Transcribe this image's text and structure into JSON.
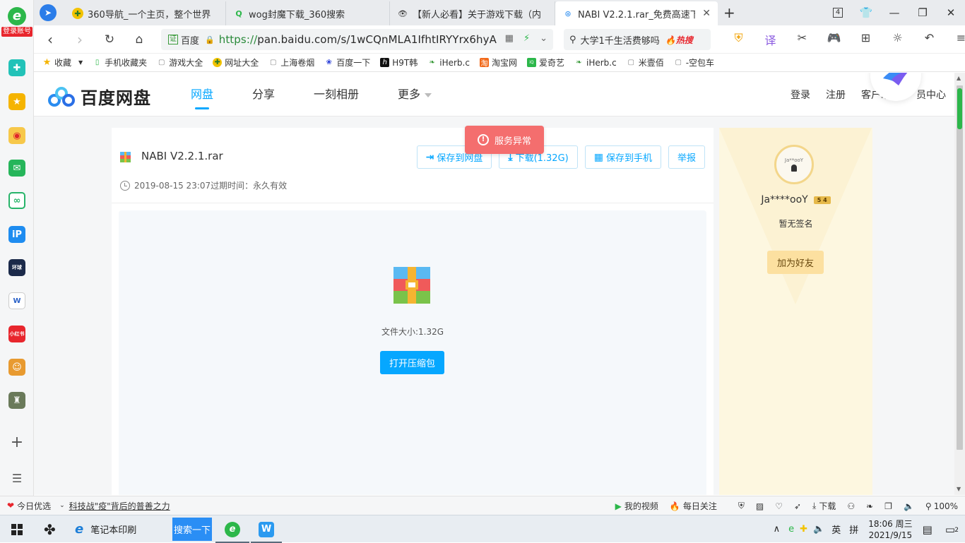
{
  "browser": {
    "login_label": "登录账号",
    "tabs": [
      {
        "title": "360导航_一个主页，整个世界"
      },
      {
        "title": "wog封魔下载_360搜索"
      },
      {
        "title": "【新人必看】关于游戏下载（内"
      },
      {
        "title": "NABI V2.2.1.rar_免费高速下载"
      }
    ],
    "tab_count": "4",
    "url_cert": "证",
    "url_cert_name": "百度",
    "url_proto": "https://",
    "url_rest": "pan.baidu.com/s/1wCQnMLA1IfhtIRYYrx6hyA",
    "search_query": "大学1千生活费够吗",
    "search_hot": "热搜",
    "bookmarks": [
      "收藏",
      "手机收藏夹",
      "游戏大全",
      "网址大全",
      "上海卷烟",
      "百度一下",
      "H9T韩",
      "iHerb.c",
      "淘宝网",
      "爱奇艺",
      "iHerb.c",
      "米壹佰",
      "-空包车"
    ]
  },
  "site": {
    "logo_text": "百度网盘",
    "nav": [
      "网盘",
      "分享",
      "一刻相册",
      "更多"
    ],
    "header_right": [
      "登录",
      "注册",
      "客户端下",
      "员中心"
    ]
  },
  "file": {
    "name": "NABI V2.2.1.rar",
    "meta": "2019-08-15 23:07过期时间：永久有效",
    "actions": {
      "save": "保存到网盘",
      "download": "下载(1.32G)",
      "save_phone": "保存到手机",
      "report": "举报"
    },
    "size_label": "文件大小:1.32G",
    "open_label": "打开压缩包"
  },
  "toast": "服务异常",
  "user": {
    "name": "Ja****ooY",
    "level": "5 4",
    "signature": "暂无签名",
    "add_friend": "加为好友",
    "avatar_text": "Ja**ooY"
  },
  "statusbar": {
    "today": "今日优选",
    "news": "科技战\"疫\"背后的普善之力",
    "video": "我的视频",
    "daily": "每日关注",
    "download": "下载",
    "zoom": "100%"
  },
  "taskbar": {
    "app1": "笔记本印刷",
    "search": "搜索一下",
    "ime": "英",
    "ime2": "拼",
    "time": "18:06 周三",
    "date": "2021/9/15",
    "notif": "2"
  },
  "colors": {
    "accent": "#06a7ff",
    "toast": "#f46e6e",
    "panel": "#fdf7e0"
  }
}
